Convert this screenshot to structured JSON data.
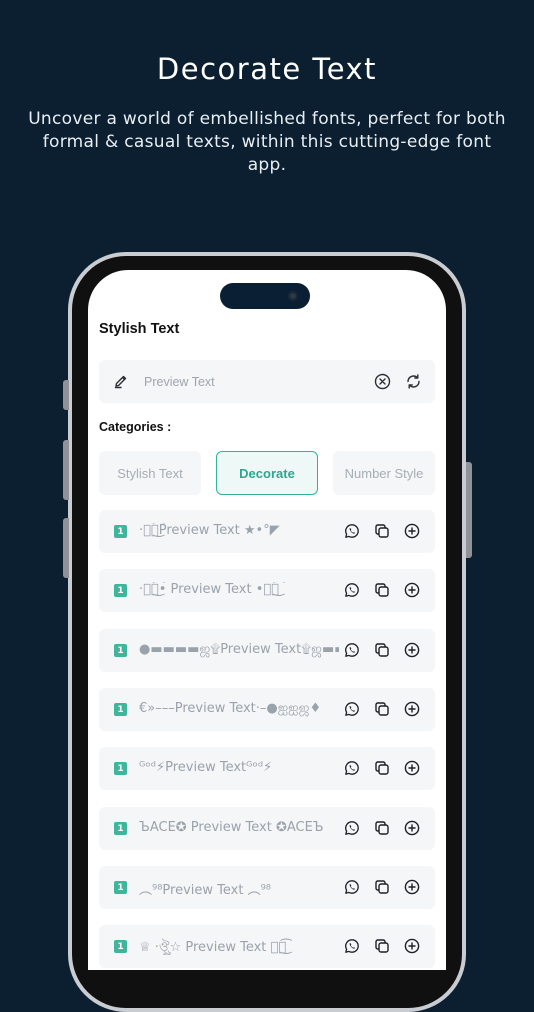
{
  "headline": "Decorate Text",
  "subtitle": "Uncover a world of embellished fonts, perfect for both formal &  casual texts, within this cutting-edge font app.",
  "app": {
    "title": "Stylish Text",
    "input": {
      "placeholder": "Preview Text",
      "value": ""
    },
    "categories_label": "Categories :",
    "categories": [
      {
        "label": "Stylish Text",
        "active": false
      },
      {
        "label": "Decorate",
        "active": true
      },
      {
        "label": "Number Style",
        "active": false
      }
    ],
    "rows": [
      {
        "index": "1",
        "text": "·ঔৣ͜͡Preview Text ★•°◤"
      },
      {
        "index": "1",
        "text": "·ঔৣ͜͡• Preview Text •ঔৣ͜͡"
      },
      {
        "index": "1",
        "text": "●▬▬▬▬ஜ۩Preview Text۩ஜ▬▬ ☆"
      },
      {
        "index": "1",
        "text": "€»–––Preview Text·–●ஐஐஜ♦"
      },
      {
        "index": "1",
        "text": "ᴳᵒᵈ⚡Preview Textᴳᵒᵈ⚡"
      },
      {
        "index": "1",
        "text": "ЪACE✪ Preview Text ✪ACEЪ"
      },
      {
        "index": "1",
        "text": "︵⁹⁸Preview Text ︵⁹⁸"
      },
      {
        "index": "1",
        "text": "♕ ·ঔৣ☆ Preview Text ঔৣ͜͡"
      }
    ]
  },
  "colors": {
    "background": "#0b1f30",
    "accent": "#3fb59c",
    "row_background": "#f5f6f8"
  },
  "icons": {
    "input": [
      "pencil-icon",
      "clear-circle-icon",
      "refresh-icon"
    ],
    "row_actions": [
      "whatsapp-icon",
      "copy-icon",
      "add-circle-icon"
    ]
  }
}
